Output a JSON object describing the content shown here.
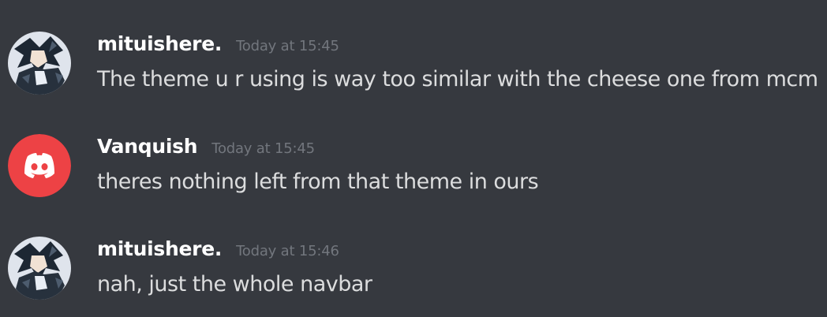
{
  "colors": {
    "background": "#36393f",
    "username": "#ffffff",
    "timestamp": "#72767d",
    "message_text": "#dcddde",
    "discord_avatar_red": "#ed4245"
  },
  "messages": [
    {
      "username": "mituishere.",
      "timestamp": "Today at 15:45",
      "text": "The theme u r using is way too similar with the cheese one from mcm",
      "avatar": "anime-character-avatar"
    },
    {
      "username": "Vanquish",
      "timestamp": "Today at 15:45",
      "text": "theres nothing left from that theme in ours",
      "avatar": "discord-logo-avatar"
    },
    {
      "username": "mituishere.",
      "timestamp": "Today at 15:46",
      "text": "nah, just the whole navbar",
      "avatar": "anime-character-avatar"
    }
  ]
}
